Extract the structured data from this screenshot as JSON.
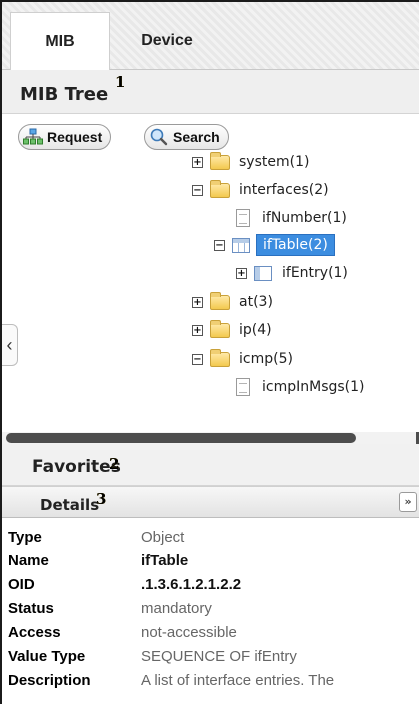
{
  "tabs": [
    {
      "label": "MIB",
      "active": true
    },
    {
      "label": "Device",
      "active": false
    }
  ],
  "mib_tree": {
    "title": "MIB Tree",
    "badge": "1",
    "buttons": {
      "request": "Request",
      "search": "Search"
    },
    "nodes": [
      {
        "label": "system(1)",
        "type": "folder",
        "expander": "⊞"
      },
      {
        "label": "interfaces(2)",
        "type": "folder",
        "expander": "⊟"
      },
      {
        "label": "ifNumber(1)",
        "type": "leaf"
      },
      {
        "label": "ifTable(2)",
        "type": "table",
        "expander": "⊟",
        "selected": true
      },
      {
        "label": "ifEntry(1)",
        "type": "entry",
        "expander": "⊞"
      },
      {
        "label": "at(3)",
        "type": "folder",
        "expander": "⊞"
      },
      {
        "label": "ip(4)",
        "type": "folder",
        "expander": "⊞"
      },
      {
        "label": "icmp(5)",
        "type": "folder",
        "expander": "⊟"
      },
      {
        "label": "icmpInMsgs(1)",
        "type": "leaf"
      }
    ]
  },
  "favorites": {
    "title": "Favorites",
    "badge": "2"
  },
  "details": {
    "title": "Details",
    "badge": "3",
    "rows": [
      {
        "label": "Type",
        "value": "Object"
      },
      {
        "label": "Name",
        "value": "ifTable"
      },
      {
        "label": "OID",
        "value": ".1.3.6.1.2.1.2.2"
      },
      {
        "label": "Status",
        "value": "mandatory"
      },
      {
        "label": "Access",
        "value": "not-accessible"
      },
      {
        "label": "Value Type",
        "value": "SEQUENCE OF ifEntry"
      },
      {
        "label": "Description",
        "value": "A list of interface entries. The"
      }
    ]
  },
  "colors": {
    "selection": "#3c8de0",
    "folder": "#f3c94f",
    "badge": "#c9a300"
  },
  "icons": [
    "request-icon",
    "search-icon",
    "folder-icon",
    "document-icon",
    "table-icon",
    "entry-icon",
    "expand-all-icon",
    "collapse-left-icon"
  ]
}
